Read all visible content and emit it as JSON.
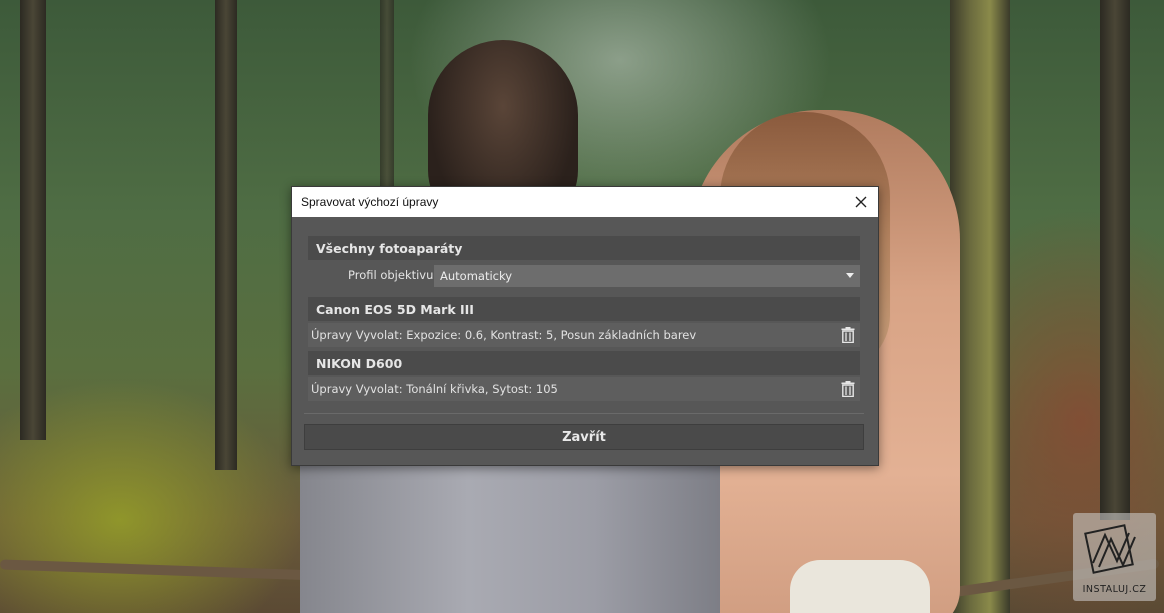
{
  "dialog": {
    "title": "Spravovat výchozí úpravy",
    "sections": [
      {
        "header": "Všechny fotoaparáty",
        "profile_label": "Profil objektivu",
        "profile_value": "Automaticky"
      },
      {
        "header": "Canon EOS 5D Mark III",
        "adjustments": "Úpravy Vyvolat: Expozice: 0.6, Kontrast: 5, Posun základních barev"
      },
      {
        "header": "NIKON D600",
        "adjustments": "Úpravy Vyvolat: Tonální křivka, Sytost: 105"
      }
    ],
    "close_label": "Zavřít"
  },
  "watermark": {
    "text": "INSTALUJ.CZ"
  },
  "icons": {
    "close": "close-icon",
    "dropdown": "chevron-down-icon",
    "delete": "trash-icon"
  },
  "colors": {
    "dialog_bg": "#575757",
    "section_header_bg": "#4b4b4b",
    "titlebar_bg": "#ffffff"
  }
}
